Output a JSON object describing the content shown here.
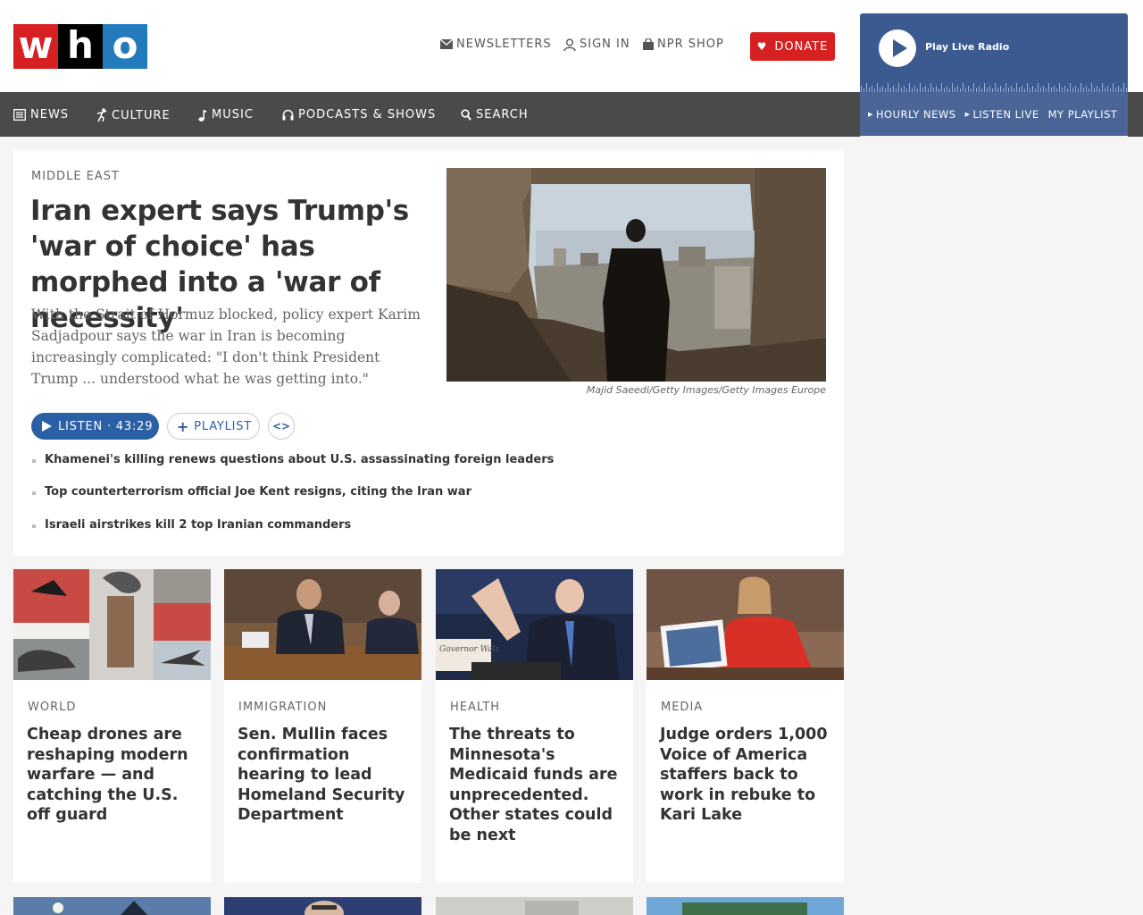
{
  "logo": {
    "letters": [
      "w",
      "h",
      "o"
    ]
  },
  "utility": {
    "newsletters": "NEWSLETTERS",
    "sign_in": "SIGN IN",
    "shop": "NPR SHOP",
    "donate": "DONATE"
  },
  "player": {
    "play_label": "Play Live Radio",
    "links": [
      "HOURLY NEWS",
      "LISTEN LIVE",
      "MY PLAYLIST"
    ]
  },
  "nav": {
    "items": [
      "NEWS",
      "CULTURE",
      "MUSIC",
      "PODCASTS & SHOWS",
      "SEARCH"
    ]
  },
  "lead": {
    "slug": "MIDDLE EAST",
    "title": "Iran expert says Trump's 'war of choice' has morphed into a 'war of necessity'",
    "teaser": "With the Strait of Hormuz blocked, policy expert Karim Sadjadpour says the war in Iran is becoming increasingly complicated: \"I don't think President Trump ... understood what he was getting into.\"",
    "credit": "Majid Saeedi/Getty Images/Getty Images Europe",
    "listen": "LISTEN · 43:29",
    "playlist": "PLAYLIST",
    "embed": "<>",
    "related": [
      "Khamenei's killing renews questions about U.S. assassinating foreign leaders",
      "Top counterterrorism official Joe Kent resigns, citing the Iran war",
      "Israeli airstrikes kill 2 top Iranian commanders"
    ]
  },
  "cards": [
    {
      "slug": "WORLD",
      "title": "Cheap drones are reshaping modern warfare — and catching the U.S. off guard"
    },
    {
      "slug": "IMMIGRATION",
      "title": "Sen. Mullin faces confirmation hearing to lead Homeland Security Department"
    },
    {
      "slug": "HEALTH",
      "title": "The threats to Minnesota's Medicaid funds are unprecedented. Other states could be next"
    },
    {
      "slug": "MEDIA",
      "title": "Judge orders 1,000 Voice of America staffers back to work in rebuke to Kari Lake"
    }
  ],
  "image_text": {
    "nameplate": "Governor Walz"
  },
  "colors": {
    "brand_red": "#d62021",
    "brand_blue": "#237bbd",
    "nav_gray": "#4a4a4a",
    "player_blue": "#3b5a90",
    "link_blue": "#2b5fa6"
  }
}
